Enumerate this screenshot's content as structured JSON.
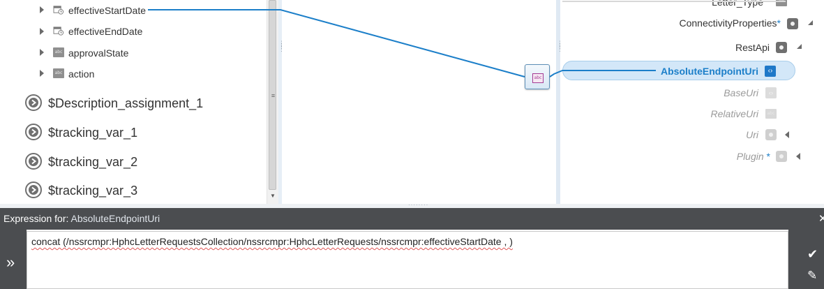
{
  "source_tree": {
    "items": [
      {
        "label": "effectiveStartDate",
        "icon": "calendar-icon"
      },
      {
        "label": "effectiveEndDate",
        "icon": "calendar-icon"
      },
      {
        "label": "approvalState",
        "icon": "abc-icon"
      },
      {
        "label": "action",
        "icon": "abc-icon"
      }
    ],
    "variables": [
      {
        "label": "$Description_assignment_1"
      },
      {
        "label": "$tracking_var_1"
      },
      {
        "label": "$tracking_var_2"
      },
      {
        "label": "$tracking_var_3"
      }
    ],
    "abc_text": "abc"
  },
  "target_tree": {
    "items": [
      {
        "label": "Letter_Type"
      },
      {
        "label": "ConnectivityProperties",
        "required": "*"
      },
      {
        "label": "RestApi"
      },
      {
        "label": "AbsoluteEndpointUri",
        "selected": true
      },
      {
        "label": "BaseUri"
      },
      {
        "label": "RelativeUri"
      },
      {
        "label": "Uri"
      },
      {
        "label": "Plugin",
        "required": "*"
      }
    ]
  },
  "mapping": {
    "node_icon_text": "abc"
  },
  "expression": {
    "header_prefix": "Expression for:",
    "target": "AbsoluteEndpointUri",
    "text": "concat (/nssrcmpr:HphcLetterRequestsCollection/nssrcmpr:HphcLetterRequests/nssrcmpr:effectiveStartDate  ,  )"
  },
  "colors": {
    "accent": "#1c7fc9",
    "header_bg": "#4b4d50",
    "selection_bg": "#d3e7f8"
  }
}
